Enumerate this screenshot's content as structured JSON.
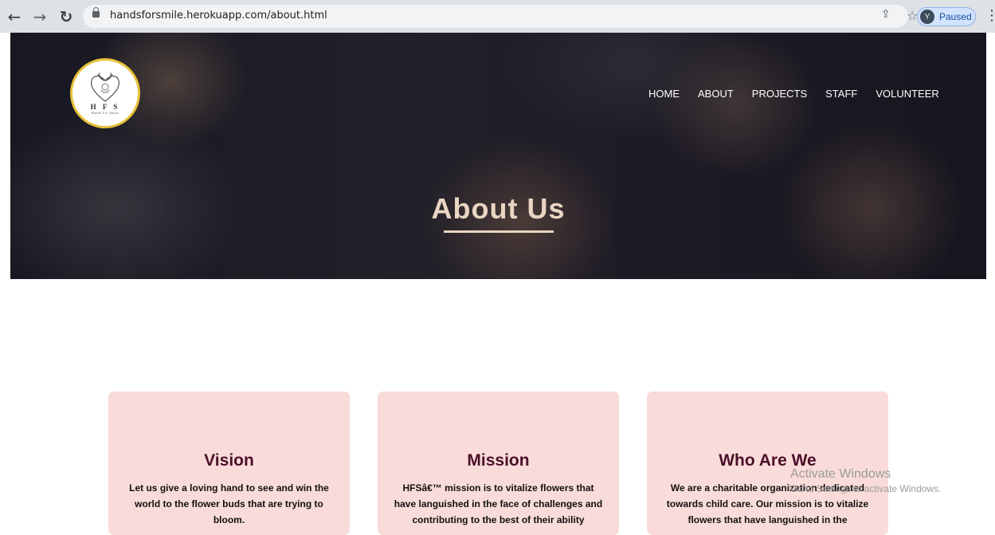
{
  "browser": {
    "url": "handsforsmile.herokuapp.com/about.html",
    "profile_initial": "Y",
    "profile_status": "Paused"
  },
  "logo": {
    "text": "H F S",
    "subtext": "Hands For Smile"
  },
  "nav": {
    "items": [
      "HOME",
      "ABOUT",
      "PROJECTS",
      "STAFF",
      "VOLUNTEER"
    ]
  },
  "hero": {
    "title": "About Us"
  },
  "cards": [
    {
      "title": "Vision",
      "text": "Let us give a loving hand to see and win the world to the flower buds that are trying to bloom."
    },
    {
      "title": "Mission",
      "text": "HFSâ€™ mission is to vitalize flowers that have languished in the face of challenges and contributing to the best of their ability"
    },
    {
      "title": "Who Are We",
      "text": "We are a charitable organization dedicated towards child care. Our mission is to vitalize flowers that have languished in the"
    }
  ],
  "watermark": {
    "line1": "Activate Windows",
    "line2": "Go to Settings to activate Windows."
  },
  "colors": {
    "card_bg": "#f9dcd9",
    "card_title": "#4b0f2a",
    "hero_title": "#ead5c2",
    "logo_border": "#e8c23a"
  }
}
